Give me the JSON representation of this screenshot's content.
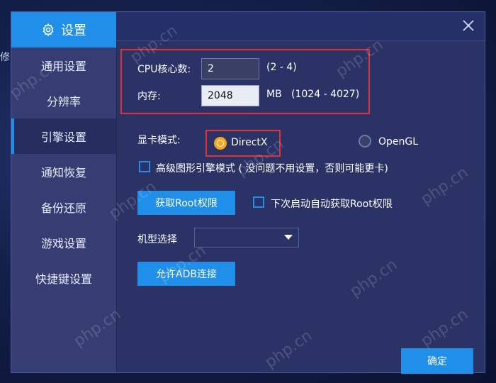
{
  "background": {
    "edge_char": "修"
  },
  "sidebar": {
    "header": {
      "icon": "gear-icon",
      "title": "设置"
    },
    "items": [
      {
        "label": "通用设置",
        "active": false
      },
      {
        "label": "分辨率",
        "active": false
      },
      {
        "label": "引擎设置",
        "active": true
      },
      {
        "label": "通知恢复",
        "active": false
      },
      {
        "label": "备份还原",
        "active": false
      },
      {
        "label": "游戏设置",
        "active": false
      },
      {
        "label": "快捷键设置",
        "active": false
      }
    ]
  },
  "engine": {
    "cpu_label": "CPU核心数:",
    "cpu_value": "2",
    "cpu_range": "(2 - 4)",
    "mem_label": "内存:",
    "mem_value": "2048",
    "mem_unit_range": "MB   (1024 - 4027)",
    "gpu_label": "显卡模式:",
    "gpu_directx": "DirectX",
    "gpu_opengl": "OpenGL",
    "advanced_checkbox": "高级图形引擎模式 ( 没问题不用设置，否则可能更卡)",
    "root_button": "获取Root权限",
    "auto_root_checkbox": "下次启动自动获取Root权限",
    "model_label": "机型选择",
    "model_value": "",
    "adb_button": "允许ADB连接",
    "confirm_button": "确定"
  },
  "watermark": "php.cn",
  "colors": {
    "accent": "#1f8fea",
    "highlight_box": "#e0303a",
    "radio_selected": "#f5a623"
  }
}
